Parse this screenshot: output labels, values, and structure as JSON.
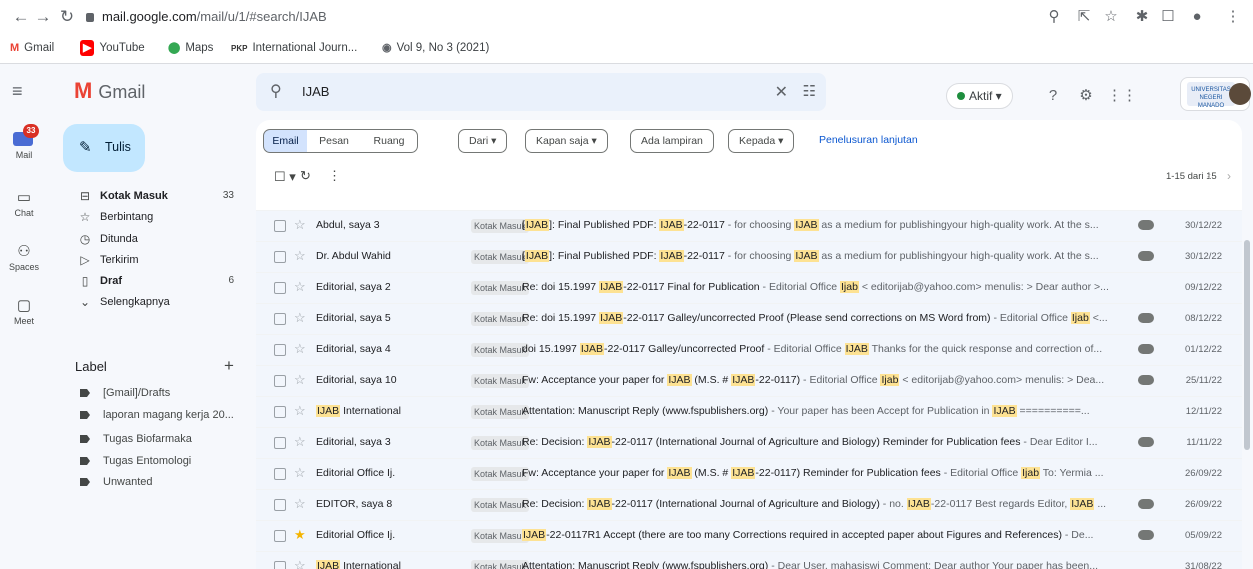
{
  "browser": {
    "url_host": "mail.google.com",
    "url_path": "/mail/u/1/#search/IJAB",
    "bookmarks": [
      {
        "icon": "gmail",
        "label": "Gmail"
      },
      {
        "icon": "youtube",
        "label": "YouTube"
      },
      {
        "icon": "maps",
        "label": "Maps"
      },
      {
        "icon": "pkp",
        "label": "International Journ..."
      },
      {
        "icon": "globe",
        "label": "Vol 9, No 3 (2021)"
      }
    ]
  },
  "header": {
    "logo": "Gmail",
    "search_value": "IJAB",
    "status": "Aktif",
    "org_logo_text": "UNIVERSITAS NEGERI MANADO"
  },
  "rail": {
    "mail_label": "Mail",
    "mail_badge": "33",
    "chat_label": "Chat",
    "spaces_label": "Spaces",
    "meet_label": "Meet"
  },
  "compose": {
    "label": "Tulis"
  },
  "nav": [
    {
      "icon": "inbox",
      "label": "Kotak Masuk",
      "count": "33",
      "bold": true
    },
    {
      "icon": "star",
      "label": "Berbintang",
      "count": "",
      "bold": false
    },
    {
      "icon": "clock",
      "label": "Ditunda",
      "count": "",
      "bold": false
    },
    {
      "icon": "send",
      "label": "Terkirim",
      "count": "",
      "bold": false
    },
    {
      "icon": "draft",
      "label": "Draf",
      "count": "6",
      "bold": true
    },
    {
      "icon": "chevron",
      "label": "Selengkapnya",
      "count": "",
      "bold": false
    }
  ],
  "labels": {
    "heading": "Label",
    "items": [
      "[Gmail]/Drafts",
      "laporan magang kerja 20...",
      "Tugas Biofarmaka",
      "Tugas Entomologi",
      "Unwanted"
    ]
  },
  "filters": {
    "segments": [
      "Email",
      "Pesan",
      "Ruang"
    ],
    "chips": [
      "Dari",
      "Kapan saja",
      "Ada lampiran",
      "Kepada"
    ],
    "advanced": "Penelusuran lanjutan"
  },
  "pager": "1-15 dari 15",
  "emails": [
    {
      "sender": "Abdul, saya 3",
      "tag": "Kotak Masuk",
      "subject": "[IJAB]: Final Published PDF: IJAB-22-0117",
      "snippet": " - for choosing IJAB as a medium for publishingyour high-quality work. At the s...",
      "attach": true,
      "date": "30/12/22",
      "starred": false
    },
    {
      "sender": "Dr. Abdul Wahid",
      "tag": "Kotak Masuk",
      "subject": "[IJAB]: Final Published PDF: IJAB-22-0117",
      "snippet": " - for choosing IJAB as a medium for publishingyour high-quality work. At the s...",
      "attach": true,
      "date": "30/12/22",
      "starred": false
    },
    {
      "sender": "Editorial, saya 2",
      "tag": "Kotak Masuk",
      "subject": "Re: doi 15.1997 IJAB-22-0117 Final for Publication",
      "snippet": " - Editorial Office Ijab < editorijab@yahoo.com> menulis: > Dear author >...",
      "attach": false,
      "date": "09/12/22",
      "starred": false
    },
    {
      "sender": "Editorial, saya 5",
      "tag": "Kotak Masuk",
      "subject": "Re: doi 15.1997 IJAB-22-0117 Galley/uncorrected Proof (Please send corrections on MS Word from)",
      "snippet": " - Editorial Office Ijab <...",
      "attach": true,
      "date": "08/12/22",
      "starred": false
    },
    {
      "sender": "Editorial, saya 4",
      "tag": "Kotak Masuk",
      "subject": "doi 15.1997 IJAB-22-0117 Galley/uncorrected Proof",
      "snippet": " - Editorial Office IJAB Thanks for the quick response and correction of...",
      "attach": true,
      "date": "01/12/22",
      "starred": false
    },
    {
      "sender": "Editorial, saya 10",
      "tag": "Kotak Masuk",
      "subject": "Fw: Acceptance your paper for IJAB (M.S. # IJAB-22-0117)",
      "snippet": " - Editorial Office Ijab < editorijab@yahoo.com> menulis: > Dea...",
      "attach": true,
      "date": "25/11/22",
      "starred": false
    },
    {
      "sender": "IJAB International",
      "tag": "Kotak Masuk",
      "subject": "Attentation: Manuscript Reply (www.fspublishers.org)",
      "snippet": " - Your paper has been Accept for Publication in IJAB ==========...",
      "attach": false,
      "date": "12/11/22",
      "starred": false
    },
    {
      "sender": "Editorial, saya 3",
      "tag": "Kotak Masuk",
      "subject": "Re: Decision: IJAB-22-0117 (International Journal of Agriculture and Biology) Reminder for Publication fees",
      "snippet": " - Dear Editor I...",
      "attach": true,
      "date": "11/11/22",
      "starred": false
    },
    {
      "sender": "Editorial Office Ij.",
      "tag": "Kotak Masuk",
      "subject": "Fw: Acceptance your paper for IJAB (M.S. # IJAB-22-0117) Reminder for Publication fees",
      "snippet": " - Editorial Office Ijab To: Yermia ...",
      "attach": false,
      "date": "26/09/22",
      "starred": false
    },
    {
      "sender": "EDITOR, saya 8",
      "tag": "Kotak Masuk",
      "subject": "Re: Decision: IJAB-22-0117 (International Journal of Agriculture and Biology)",
      "snippet": " - no. IJAB-22-0117 Best regards Editor, IJAB ...",
      "attach": true,
      "date": "26/09/22",
      "starred": false
    },
    {
      "sender": "Editorial Office Ij.",
      "tag": "Kotak Masuk",
      "subject": "IJAB-22-0117R1 Accept (there are too many Corrections required in accepted paper about Figures and References)",
      "snippet": " - De...",
      "attach": true,
      "date": "05/09/22",
      "starred": true
    },
    {
      "sender": "IJAB International",
      "tag": "Kotak Masuk",
      "subject": "Attentation: Manuscript Reply (www.fspublishers.org)",
      "snippet": " - Dear User, mahasiswi Comment: Dear author Your paper has been...",
      "attach": false,
      "date": "31/08/22",
      "starred": false
    }
  ]
}
